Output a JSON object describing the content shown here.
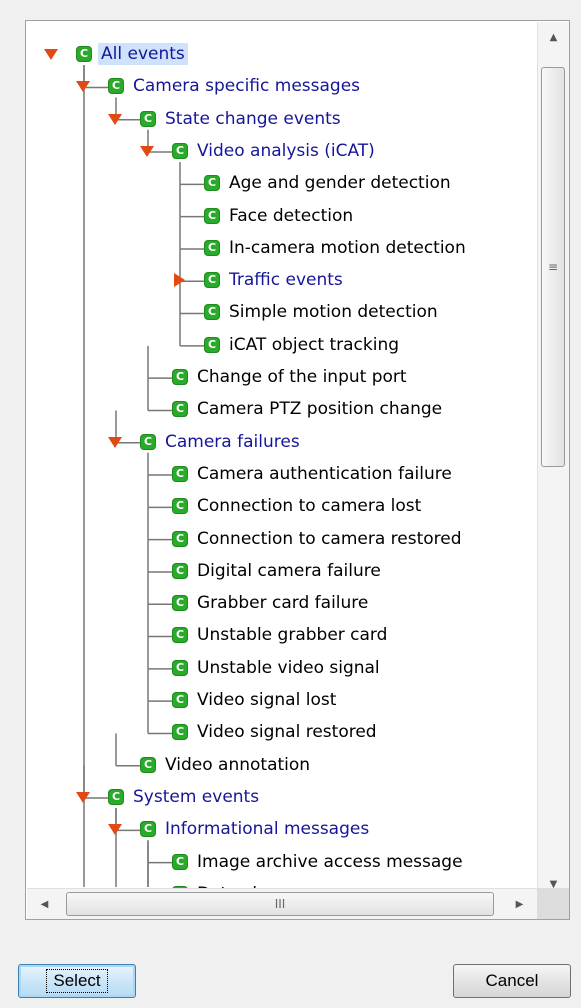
{
  "tree": {
    "nodes": [
      {
        "label": "All events",
        "level": 0,
        "expanded": "down",
        "parent": true,
        "selected": true
      },
      {
        "label": "Camera specific messages",
        "level": 1,
        "expanded": "down",
        "parent": true
      },
      {
        "label": "State change events",
        "level": 2,
        "expanded": "down",
        "parent": true
      },
      {
        "label": "Video analysis (iCAT)",
        "level": 3,
        "expanded": "down",
        "parent": true
      },
      {
        "label": "Age and gender detection",
        "level": 4
      },
      {
        "label": "Face detection",
        "level": 4
      },
      {
        "label": "In-camera motion detection",
        "level": 4
      },
      {
        "label": "Traffic events",
        "level": 4,
        "expanded": "right",
        "parent": true
      },
      {
        "label": "Simple motion detection",
        "level": 4
      },
      {
        "label": "iCAT object tracking",
        "level": 4,
        "last": true
      },
      {
        "label": "Change of the input port",
        "level": 3
      },
      {
        "label": "Camera PTZ position change",
        "level": 3,
        "last": true
      },
      {
        "label": "Camera failures",
        "level": 2,
        "expanded": "down",
        "parent": true
      },
      {
        "label": "Camera authentication failure",
        "level": 3
      },
      {
        "label": "Connection to camera lost",
        "level": 3
      },
      {
        "label": "Connection to camera restored",
        "level": 3
      },
      {
        "label": "Digital camera failure",
        "level": 3
      },
      {
        "label": "Grabber card failure",
        "level": 3
      },
      {
        "label": "Unstable grabber card",
        "level": 3
      },
      {
        "label": "Unstable video signal",
        "level": 3
      },
      {
        "label": "Video signal lost",
        "level": 3
      },
      {
        "label": "Video signal restored",
        "level": 3,
        "last": true
      },
      {
        "label": "Video annotation",
        "level": 2,
        "last": true
      },
      {
        "label": "System events",
        "level": 1,
        "expanded": "down",
        "parent": true
      },
      {
        "label": "Informational messages",
        "level": 2,
        "expanded": "down",
        "parent": true
      },
      {
        "label": "Image archive access message",
        "level": 3
      },
      {
        "label": "Data change",
        "level": 3
      }
    ],
    "node_icon_letter": "C",
    "icon_color": "#2aaa2a",
    "expander_color": "#e34a12",
    "parent_label_color": "#15169a",
    "selection_color": "#cfe2fb"
  },
  "scrollbars": {
    "vertical": {
      "up_arrow": "▲",
      "down_arrow": "▼",
      "grip": "≡"
    },
    "horizontal": {
      "left_arrow": "◀",
      "right_arrow": "▶",
      "grip": "III"
    }
  },
  "buttons": {
    "select_label": "Select",
    "cancel_label": "Cancel"
  }
}
